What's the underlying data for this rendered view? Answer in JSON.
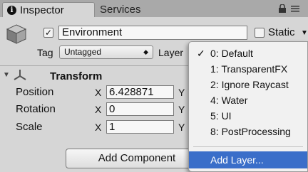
{
  "tabs": {
    "inspector": "Inspector",
    "services": "Services"
  },
  "object": {
    "name": "Environment",
    "active_check": "✓",
    "static_label": "Static",
    "tag_label": "Tag",
    "tag_value": "Untagged",
    "layer_label": "Layer"
  },
  "transform": {
    "title": "Transform",
    "rows": [
      {
        "label": "Position",
        "x_axis": "X",
        "x_value": "6.428871",
        "y_axis": "Y"
      },
      {
        "label": "Rotation",
        "x_axis": "X",
        "x_value": "0",
        "y_axis": "Y"
      },
      {
        "label": "Scale",
        "x_axis": "X",
        "x_value": "1",
        "y_axis": "Y"
      }
    ]
  },
  "add_component_label": "Add Component",
  "layer_menu": {
    "checkmark": "✓",
    "items": [
      "0: Default",
      "1: TransparentFX",
      "2: Ignore Raycast",
      "4: Water",
      "5: UI",
      "8: PostProcessing"
    ],
    "add_layer": "Add Layer...",
    "selected_index": 0,
    "highlight_color": "#3a6ec9"
  },
  "icons": [
    "info-icon",
    "lock-icon",
    "menu-icon",
    "cube-icon",
    "transform-icon"
  ]
}
